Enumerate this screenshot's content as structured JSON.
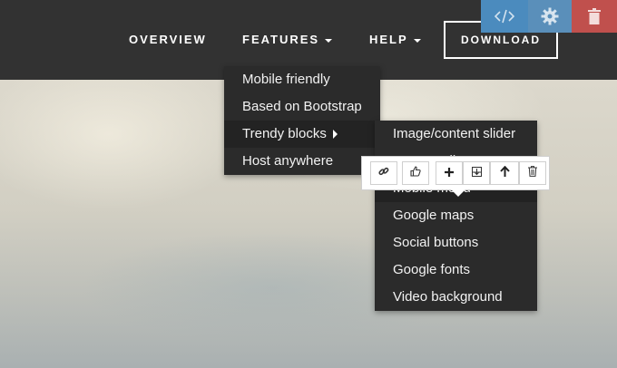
{
  "nav": {
    "overview": "OVERVIEW",
    "features": "FEATURES",
    "help": "HELP",
    "download": "DOWNLOAD"
  },
  "editor_tools": {
    "code_icon": "code-icon",
    "gear_icon": "gear-icon",
    "trash_icon": "trash-icon",
    "code_color": "#4b8bbe",
    "delete_color": "#c0504d"
  },
  "features_menu": {
    "items": [
      "Mobile friendly",
      "Based on Bootstrap",
      "Trendy blocks",
      "Host anywhere"
    ]
  },
  "trendy_submenu": {
    "items": [
      "Image/content slider",
      "Image gallery",
      "Mobile menu",
      "Google maps",
      "Social buttons",
      "Google fonts",
      "Video background"
    ]
  },
  "block_toolbar": {
    "icons": [
      "link-icon",
      "thumbs-up-icon",
      "plus-icon",
      "insert-below-icon",
      "arrow-up-icon",
      "trash-icon"
    ]
  }
}
